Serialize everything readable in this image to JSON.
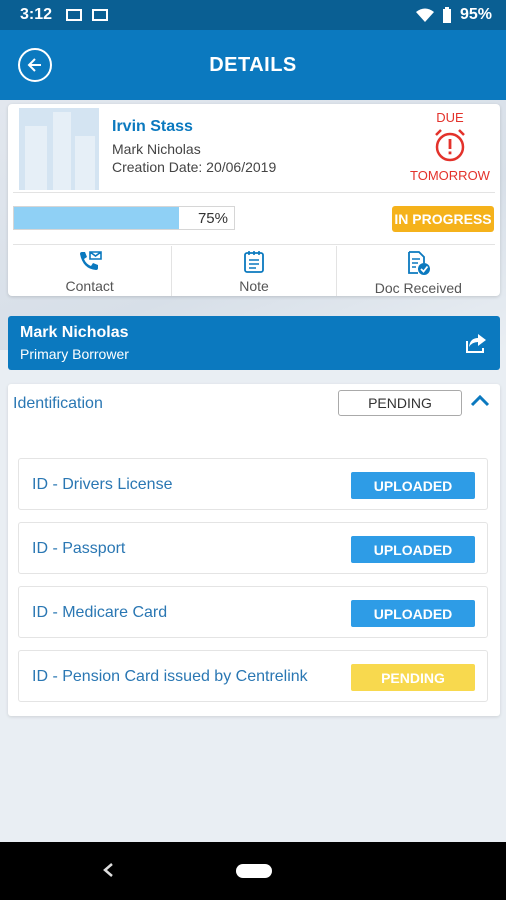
{
  "status_bar": {
    "time": "3:12",
    "battery": "95%"
  },
  "header": {
    "title": "DETAILS"
  },
  "loan_card": {
    "name": "Irvin Stass",
    "contact": "Mark Nicholas",
    "creation_date": "Creation Date: 20/06/2019",
    "due_top": "DUE",
    "due_bottom": "TOMORROW",
    "progress_percent": 75,
    "progress_label": "75%",
    "status": "IN PROGRESS",
    "actions": [
      {
        "label": "Contact",
        "icon": "contact-phone-icon"
      },
      {
        "label": "Note",
        "icon": "note-icon"
      },
      {
        "label": "Doc Received",
        "icon": "doc-received-icon"
      }
    ]
  },
  "borrower": {
    "name": "Mark Nicholas",
    "role": "Primary Borrower"
  },
  "identification": {
    "title": "Identification",
    "status": "PENDING",
    "items": [
      {
        "label": "ID - Drivers License",
        "status": "UPLOADED"
      },
      {
        "label": "ID - Passport",
        "status": "UPLOADED"
      },
      {
        "label": "ID - Medicare Card",
        "status": "UPLOADED"
      },
      {
        "label": "ID - Pension Card issued by Centrelink",
        "status": "PENDING"
      }
    ]
  },
  "colors": {
    "primary": "#0b79bf",
    "due_red": "#e3322b",
    "in_progress": "#f5b21b",
    "uploaded": "#2e9ce6",
    "pending": "#f8d94e"
  }
}
